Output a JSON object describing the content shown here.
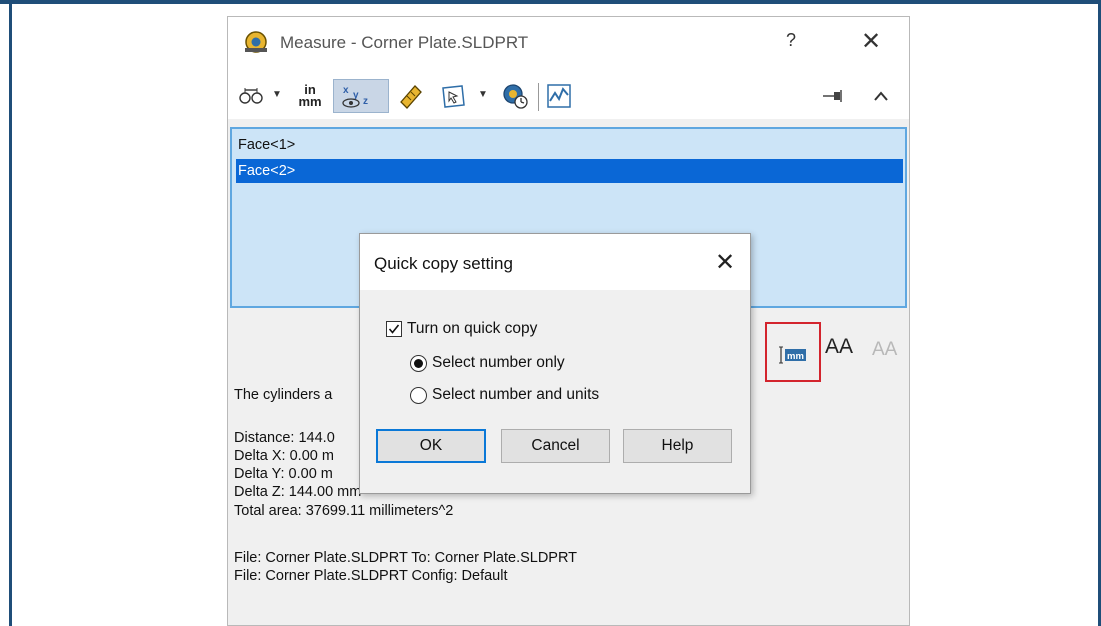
{
  "window": {
    "title": "Measure - Corner Plate.SLDPRT",
    "help_label": "?",
    "close_label": "✕"
  },
  "toolbar": {
    "units_label_top": "in",
    "units_label_bottom": "mm",
    "icons": [
      "arc-circle-measurements-icon",
      "units-precision-icon",
      "show-xyz-measurements-icon",
      "point-to-point-icon",
      "projection-icon",
      "history-icon",
      "sensor-icon",
      "pin-icon",
      "collapse-icon"
    ]
  },
  "selection_list": {
    "items": [
      {
        "label": "Face<1>",
        "selected": false
      },
      {
        "label": "Face<2>",
        "selected": true
      }
    ]
  },
  "results": {
    "line1": "The cylinders a",
    "distance": "Distance: 144.0",
    "delta_x": "Delta X: 0.00 m",
    "delta_y": "Delta Y: 0.00 m",
    "delta_z": "Delta Z: 144.00 mm",
    "total_area": "Total area: 37699.11 millimeters^2",
    "file_to": "File: Corner Plate.SLDPRT To: Corner Plate.SLDPRT",
    "file_config": "File: Corner Plate.SLDPRT Config: Default"
  },
  "side_tools": {
    "units_icon_text": "mm",
    "increase_font": "AA",
    "decrease_font": "AA"
  },
  "dialog": {
    "title": "Quick copy setting",
    "close_label": "✕",
    "checkbox_label": "Turn on quick copy",
    "checkbox_checked": true,
    "radio_options": [
      {
        "label": "Select number only",
        "selected": true
      },
      {
        "label": "Select number and units",
        "selected": false
      }
    ],
    "ok_label": "OK",
    "cancel_label": "Cancel",
    "help_label": "Help"
  },
  "colors": {
    "selection_blue": "#0a67d6",
    "list_background": "#cce4f7",
    "highlight_red": "#d3242d",
    "frame_blue": "#1f4e79"
  }
}
